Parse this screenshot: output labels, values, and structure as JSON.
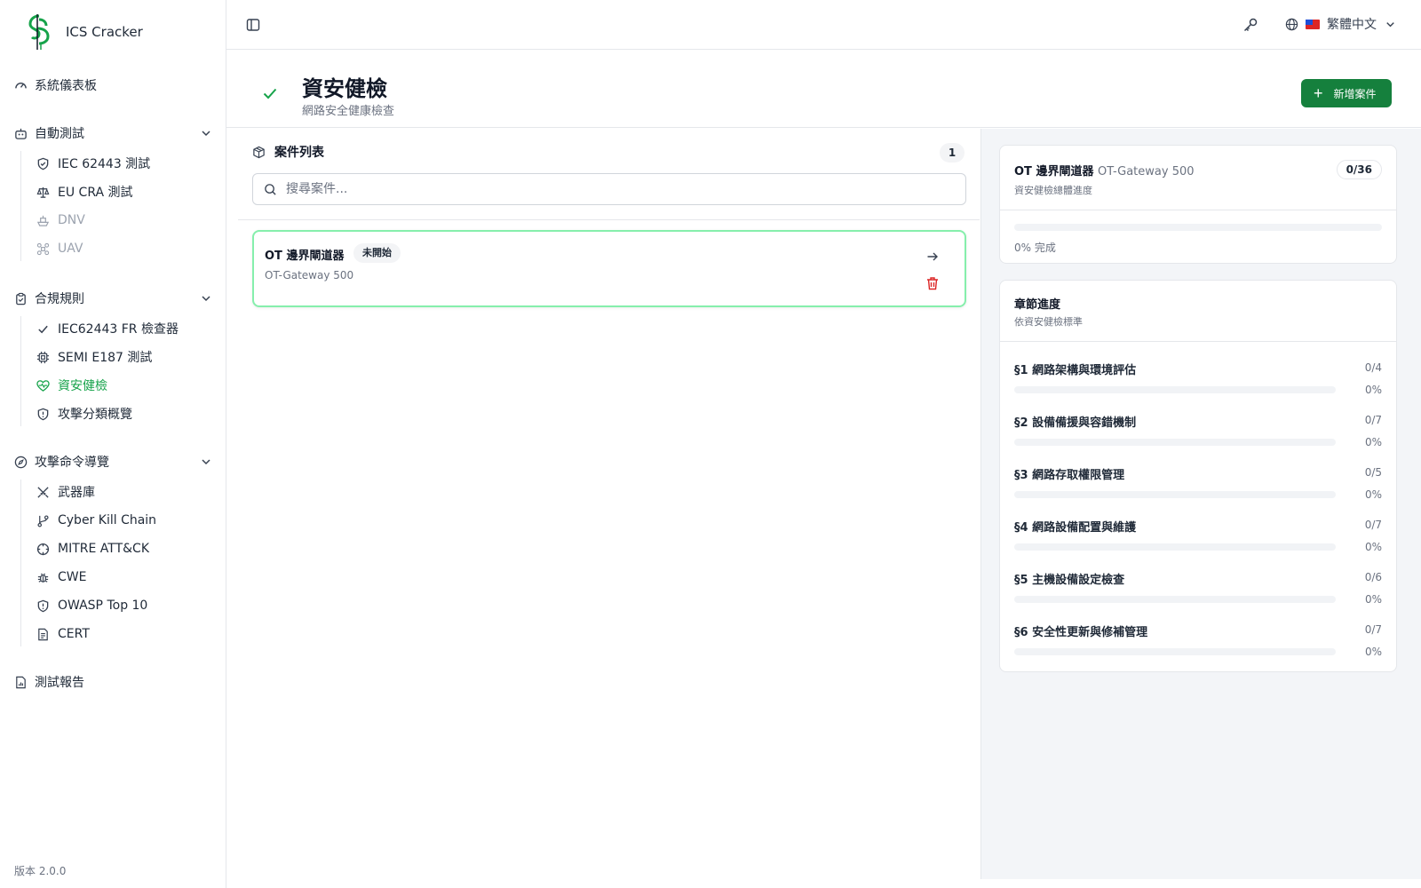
{
  "app": {
    "name": "ICS Cracker",
    "version": "版本 2.0.0"
  },
  "sidebar": {
    "dashboard": "系統儀表板",
    "groups": [
      {
        "label": "自動測試",
        "items": [
          {
            "label": "IEC 62443 測試",
            "icon": "shield-check-icon"
          },
          {
            "label": "EU CRA 測試",
            "icon": "scale-icon"
          },
          {
            "label": "DNV",
            "icon": "ship-icon",
            "disabled": true
          },
          {
            "label": "UAV",
            "icon": "drone-icon",
            "disabled": true
          }
        ]
      },
      {
        "label": "合規規則",
        "items": [
          {
            "label": "IEC62443 FR 檢查器",
            "icon": "check-icon"
          },
          {
            "label": "SEMI E187 測試",
            "icon": "chip-icon"
          },
          {
            "label": "資安健檢",
            "icon": "heart-pulse-icon",
            "active": true
          },
          {
            "label": "攻擊分類概覽",
            "icon": "shield-alert-icon"
          }
        ]
      },
      {
        "label": "攻擊命令導覽",
        "items": [
          {
            "label": "武器庫",
            "icon": "swords-icon"
          },
          {
            "label": "Cyber Kill Chain",
            "icon": "git-branch-icon"
          },
          {
            "label": "MITRE ATT&CK",
            "icon": "crosshair-icon"
          },
          {
            "label": "CWE",
            "icon": "bug-icon"
          },
          {
            "label": "OWASP Top 10",
            "icon": "shield-alert-icon"
          },
          {
            "label": "CERT",
            "icon": "document-icon"
          }
        ]
      }
    ],
    "reports": "測試報告"
  },
  "topbar": {
    "language": "繁體中文"
  },
  "page": {
    "title": "資安健檢",
    "subtitle": "網路安全健康檢查",
    "new_case_label": "新增案件"
  },
  "case_list": {
    "title": "案件列表",
    "count": "1",
    "search_placeholder": "搜尋案件...",
    "cases": [
      {
        "title": "OT 邊界閘道器",
        "status": "未開始",
        "model": "OT-Gateway 500"
      }
    ]
  },
  "overall": {
    "title": "OT 邊界閘道器",
    "model": "OT-Gateway 500",
    "subtitle": "資安健檢總體進度",
    "score": "0/36",
    "progress": 0,
    "progress_label": "0% 完成"
  },
  "chapters": {
    "title": "章節進度",
    "subtitle": "依資安健檢標準",
    "items": [
      {
        "label": "§1 網路架構與環境評估",
        "count": "0/4",
        "percent": "0%",
        "progress": 0
      },
      {
        "label": "§2 設備備援與容錯機制",
        "count": "0/7",
        "percent": "0%",
        "progress": 0
      },
      {
        "label": "§3 網路存取權限管理",
        "count": "0/5",
        "percent": "0%",
        "progress": 0
      },
      {
        "label": "§4 網路設備配置與維護",
        "count": "0/7",
        "percent": "0%",
        "progress": 0
      },
      {
        "label": "§5 主機設備設定檢查",
        "count": "0/6",
        "percent": "0%",
        "progress": 0
      },
      {
        "label": "§6 安全性更新與修補管理",
        "count": "0/7",
        "percent": "0%",
        "progress": 0
      }
    ]
  },
  "colors": {
    "accent": "#16a34a",
    "button": "#15803d",
    "danger": "#dc2626"
  }
}
